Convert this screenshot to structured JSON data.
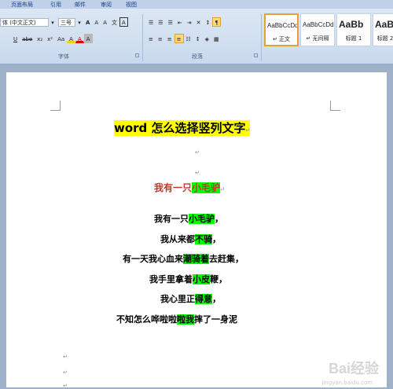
{
  "tabs": [
    "页面布局",
    "引用",
    "邮件",
    "审阅",
    "视图"
  ],
  "font": {
    "name": "体 (中文正文)",
    "size": "三号",
    "grow": "A",
    "shrink": "A",
    "clear": "A",
    "phonetic": "文",
    "border": "A"
  },
  "fmt_row2": [
    "U",
    "abe",
    "x₂",
    "x²",
    "Aa",
    "A",
    "A",
    "A"
  ],
  "para_row": [
    "≡",
    "≡",
    "≡",
    "≡",
    "¶"
  ],
  "groups": {
    "font_label": "字体",
    "para_label": "段落"
  },
  "styles": [
    {
      "preview": "AaBbCcDd",
      "name": "↵ 正文"
    },
    {
      "preview": "AaBbCcDd",
      "name": "↵ 无间隔"
    },
    {
      "preview": "AaBb",
      "name": "标题 1"
    },
    {
      "preview": "AaBb",
      "name": "标题 2"
    }
  ],
  "doc": {
    "title": "word 怎么选择竖列文字",
    "para_mark": "↵",
    "subtitle_pre": "我有一只",
    "subtitle_hl": "小毛驴",
    "lines": [
      {
        "pre": "我有一只",
        "hl": "小毛驴",
        "post": "，"
      },
      {
        "pre": "我从来都",
        "hl": "不骑",
        "post": "，"
      },
      {
        "pre": "有一天我心血来",
        "hl": "潮骑着",
        "post": "去赶集，"
      },
      {
        "pre": "我手里拿着",
        "hl": "小皮",
        "post": "鞭，"
      },
      {
        "pre": "我心里正",
        "hl": "得意",
        "post": "，"
      },
      {
        "pre": "不知怎么哗啦啦",
        "hl": "啦我",
        "post": "摔了一身泥"
      }
    ]
  },
  "watermark": {
    "text": "Bai经验",
    "sub": "jingyan.baidu.com"
  }
}
